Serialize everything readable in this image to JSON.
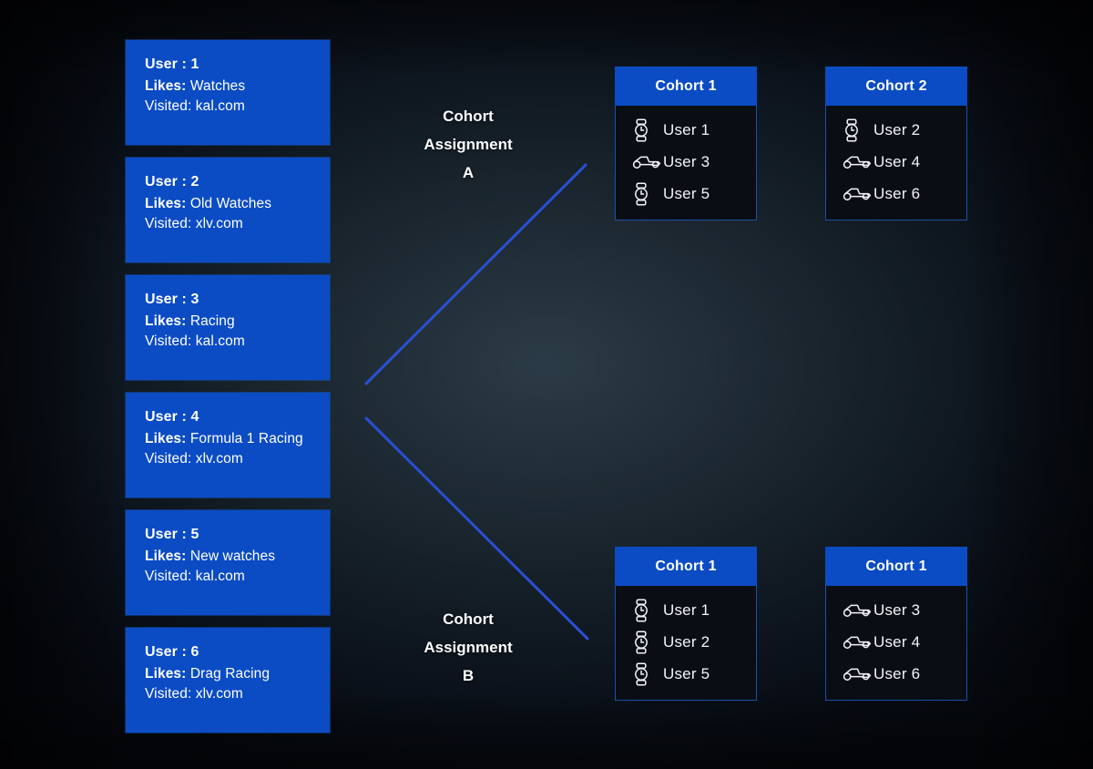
{
  "colors": {
    "card_blue": "#0B4CC4",
    "line_blue": "#2A4FD6",
    "cohort_border": "#1b4fa8",
    "text_white": "#ffffff",
    "background_dark": "#0a0e14"
  },
  "users": [
    {
      "title": "User : 1",
      "likes_label": "Likes:",
      "likes": "Watches",
      "visited_label": "Visited:",
      "visited": "kal.com"
    },
    {
      "title": "User : 2",
      "likes_label": "Likes:",
      "likes": "Old Watches",
      "visited_label": "Visited:",
      "visited": "xlv.com"
    },
    {
      "title": "User : 3",
      "likes_label": "Likes:",
      "likes": "Racing",
      "visited_label": "Visited:",
      "visited": "kal.com"
    },
    {
      "title": "User : 4",
      "likes_label": "Likes:",
      "likes": "Formula 1 Racing",
      "visited_label": "Visited:",
      "visited": "xlv.com"
    },
    {
      "title": "User : 5",
      "likes_label": "Likes:",
      "likes": "New watches",
      "visited_label": "Visited:",
      "visited": "kal.com"
    },
    {
      "title": "User : 6",
      "likes_label": "Likes:",
      "likes": "Drag Racing",
      "visited_label": "Visited:",
      "visited": "xlv.com"
    }
  ],
  "assignments": [
    {
      "line1": "Cohort",
      "line2": "Assignment",
      "line3": "A"
    },
    {
      "line1": "Cohort",
      "line2": "Assignment",
      "line3": "B"
    }
  ],
  "cohorts": [
    {
      "title": "Cohort 1",
      "members": [
        {
          "icon": "watch-icon",
          "label": "User 1"
        },
        {
          "icon": "race-car-icon",
          "label": "User 3"
        },
        {
          "icon": "watch-icon",
          "label": "User 5"
        }
      ]
    },
    {
      "title": "Cohort 2",
      "members": [
        {
          "icon": "watch-icon",
          "label": "User 2"
        },
        {
          "icon": "race-car-icon",
          "label": "User 4"
        },
        {
          "icon": "race-car-icon",
          "label": "User 6"
        }
      ]
    },
    {
      "title": "Cohort 1",
      "members": [
        {
          "icon": "watch-icon",
          "label": "User 1"
        },
        {
          "icon": "watch-icon",
          "label": "User 2"
        },
        {
          "icon": "watch-icon",
          "label": "User 5"
        }
      ]
    },
    {
      "title": "Cohort 1",
      "members": [
        {
          "icon": "race-car-icon",
          "label": "User 3"
        },
        {
          "icon": "race-car-icon",
          "label": "User 4"
        },
        {
          "icon": "race-car-icon",
          "label": "User 6"
        }
      ]
    }
  ]
}
